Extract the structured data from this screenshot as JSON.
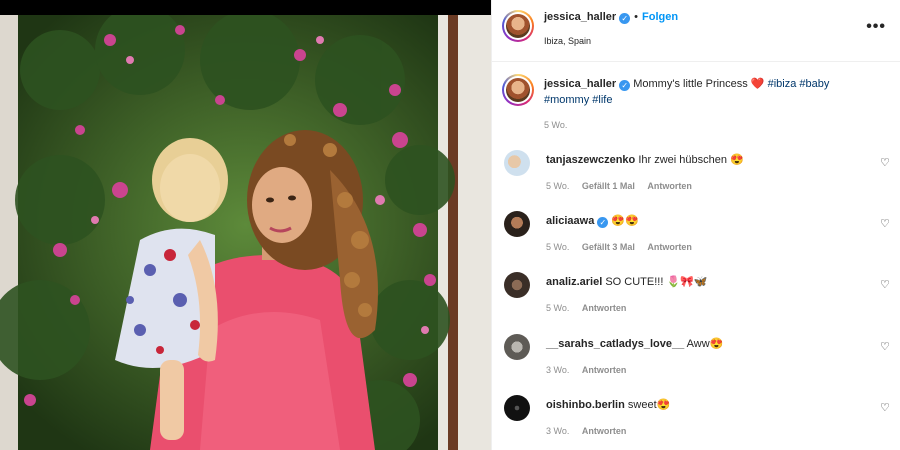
{
  "post": {
    "username": "jessica_haller",
    "follow_label": "Folgen",
    "location": "Ibiza, Spain",
    "more_label": "•••"
  },
  "caption": {
    "username": "jessica_haller",
    "text": "Mommy's little Princess ❤️",
    "hashtags": [
      "#ibiza",
      "#baby",
      "#mommy",
      "#life"
    ],
    "time": "5 Wo."
  },
  "comments": [
    {
      "username": "tanjaszewczenko",
      "verified": false,
      "text": "Ihr zwei hübschen 😍",
      "time": "5 Wo.",
      "likes": "Gefällt 1 Mal",
      "reply": "Antworten"
    },
    {
      "username": "aliciaawa",
      "verified": true,
      "text": "😍😍",
      "time": "5 Wo.",
      "likes": "Gefällt 3 Mal",
      "reply": "Antworten"
    },
    {
      "username": "analiz.ariel",
      "verified": false,
      "text": "SO CUTE!!! 🌷🎀🦋",
      "time": "5 Wo.",
      "likes": "",
      "reply": "Antworten"
    },
    {
      "username": "__sarahs_catladys_love__",
      "verified": false,
      "text": "Aww😍",
      "time": "3 Wo.",
      "likes": "",
      "reply": "Antworten"
    },
    {
      "username": "oishinbo.berlin",
      "verified": false,
      "text": "sweet😍",
      "time": "3 Wo.",
      "likes": "",
      "reply": "Antworten"
    }
  ],
  "colors": {
    "accent": "#0095f6",
    "verified": "#3897f0",
    "hashtag": "#00376b",
    "muted": "#8e8e8e"
  }
}
